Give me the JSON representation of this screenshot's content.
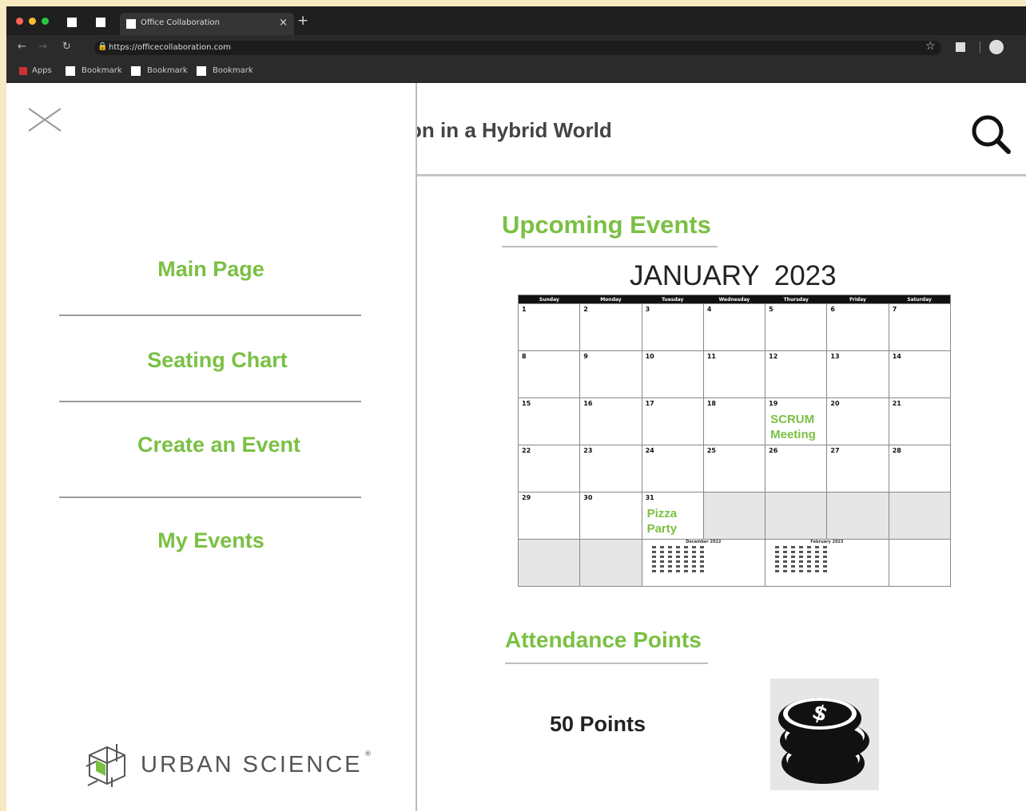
{
  "browser": {
    "tab_title": "Office Collaboration",
    "tab_close": "×",
    "new_tab": "+",
    "url": "https://officecollaboration.com",
    "bookmarks": [
      {
        "label": "Apps"
      },
      {
        "label": "Bookmark"
      },
      {
        "label": "Bookmark"
      },
      {
        "label": "Bookmark"
      }
    ]
  },
  "sidebar": {
    "nav": [
      {
        "label": "Main Page"
      },
      {
        "label": "Seating Chart"
      },
      {
        "label": "Create an Event"
      },
      {
        "label": "My Events"
      }
    ],
    "logo_text": "URBAN SCIENCE",
    "logo_mark": "®"
  },
  "header": {
    "title": "on in a Hybrid World"
  },
  "upcoming": {
    "heading": "Upcoming Events",
    "month": "JANUARY",
    "year": "2023",
    "weekdays": [
      "Sunday",
      "Monday",
      "Tuesday",
      "Wednesday",
      "Thursday",
      "Friday",
      "Saturday"
    ],
    "weeks": [
      [
        {
          "day": "1"
        },
        {
          "day": "2"
        },
        {
          "day": "3"
        },
        {
          "day": "4"
        },
        {
          "day": "5"
        },
        {
          "day": "6"
        },
        {
          "day": "7"
        }
      ],
      [
        {
          "day": "8"
        },
        {
          "day": "9"
        },
        {
          "day": "10"
        },
        {
          "day": "11"
        },
        {
          "day": "12"
        },
        {
          "day": "13"
        },
        {
          "day": "14"
        }
      ],
      [
        {
          "day": "15"
        },
        {
          "day": "16"
        },
        {
          "day": "17"
        },
        {
          "day": "18"
        },
        {
          "day": "19",
          "event": "SCRUM Meeting"
        },
        {
          "day": "20"
        },
        {
          "day": "21"
        }
      ],
      [
        {
          "day": "22"
        },
        {
          "day": "23"
        },
        {
          "day": "24"
        },
        {
          "day": "25"
        },
        {
          "day": "26"
        },
        {
          "day": "27"
        },
        {
          "day": "28"
        }
      ],
      [
        {
          "day": "29"
        },
        {
          "day": "30"
        },
        {
          "day": "31",
          "event": "Pizza Party"
        },
        {
          "day": "",
          "empty": true
        },
        {
          "day": "",
          "empty": true
        },
        {
          "day": "",
          "empty": true
        },
        {
          "day": "",
          "empty": true
        }
      ]
    ],
    "mini_calendars": [
      {
        "title": "December 2022"
      },
      {
        "title": "February 2023"
      }
    ]
  },
  "attendance": {
    "heading": "Attendance Points",
    "points": "50 Points",
    "icon": "coins-icon"
  },
  "colors": {
    "accent": "#7ac043",
    "chrome": "#2b2b2b"
  }
}
